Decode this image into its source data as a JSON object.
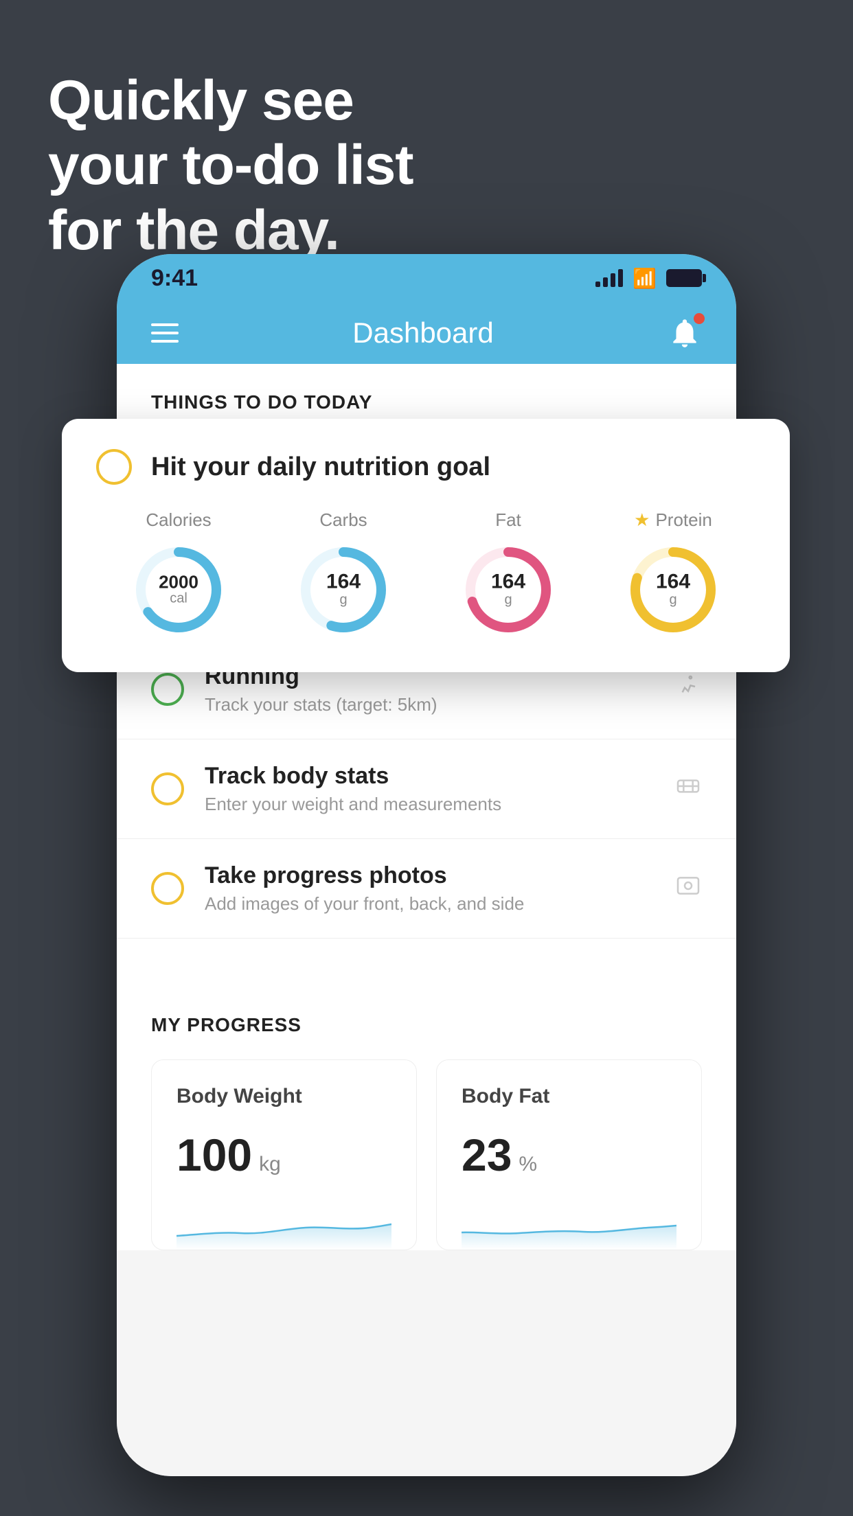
{
  "background": {
    "color": "#3a3f47"
  },
  "headline": {
    "line1": "Quickly see",
    "line2": "your to-do list",
    "line3": "for the day."
  },
  "statusBar": {
    "time": "9:41",
    "background": "#55b8e0"
  },
  "navBar": {
    "title": "Dashboard",
    "background": "#55b8e0"
  },
  "thingsSection": {
    "header": "THINGS TO DO TODAY"
  },
  "nutritionCard": {
    "title": "Hit your daily nutrition goal",
    "items": [
      {
        "label": "Calories",
        "value": "2000",
        "unit": "cal",
        "color": "#55b8e0",
        "percent": 65,
        "starred": false
      },
      {
        "label": "Carbs",
        "value": "164",
        "unit": "g",
        "color": "#55b8e0",
        "percent": 55,
        "starred": false
      },
      {
        "label": "Fat",
        "value": "164",
        "unit": "g",
        "color": "#e05580",
        "percent": 70,
        "starred": false
      },
      {
        "label": "Protein",
        "value": "164",
        "unit": "g",
        "color": "#f0c030",
        "percent": 80,
        "starred": true
      }
    ]
  },
  "listItems": [
    {
      "title": "Running",
      "subtitle": "Track your stats (target: 5km)",
      "checkboxColor": "green",
      "icon": "👟"
    },
    {
      "title": "Track body stats",
      "subtitle": "Enter your weight and measurements",
      "checkboxColor": "yellow",
      "icon": "⚖"
    },
    {
      "title": "Take progress photos",
      "subtitle": "Add images of your front, back, and side",
      "checkboxColor": "yellow",
      "icon": "👤"
    }
  ],
  "progressSection": {
    "header": "MY PROGRESS",
    "cards": [
      {
        "title": "Body Weight",
        "value": "100",
        "unit": "kg"
      },
      {
        "title": "Body Fat",
        "value": "23",
        "unit": "%"
      }
    ]
  }
}
